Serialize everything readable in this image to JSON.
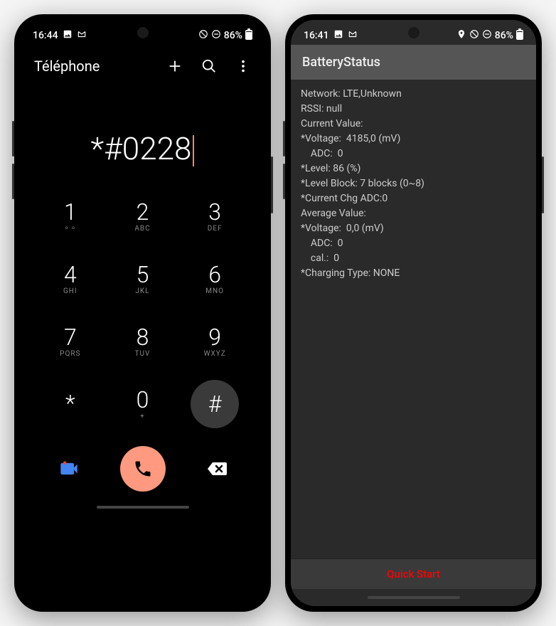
{
  "phone1": {
    "status": {
      "time": "16:44",
      "battery_text": "86%"
    },
    "header": {
      "title": "Téléphone"
    },
    "dialed": "*#0228",
    "keys": [
      {
        "digit": "1",
        "letters": "⚬⚬"
      },
      {
        "digit": "2",
        "letters": "ABC"
      },
      {
        "digit": "3",
        "letters": "DEF"
      },
      {
        "digit": "4",
        "letters": "GHI"
      },
      {
        "digit": "5",
        "letters": "JKL"
      },
      {
        "digit": "6",
        "letters": "MNO"
      },
      {
        "digit": "7",
        "letters": "PQRS"
      },
      {
        "digit": "8",
        "letters": "TUV"
      },
      {
        "digit": "9",
        "letters": "WXYZ"
      },
      {
        "digit": "*",
        "letters": ""
      },
      {
        "digit": "0",
        "letters": "+"
      },
      {
        "digit": "#",
        "letters": ""
      }
    ]
  },
  "phone2": {
    "status": {
      "time": "16:41",
      "battery_text": "86%"
    },
    "header_title": "BatteryStatus",
    "lines": [
      "Network: LTE,Unknown",
      "RSSI: null",
      "",
      "Current Value:",
      "*Voltage:  4185,0 (mV)",
      "    ADC:  0",
      "*Level: 86 (%)",
      "*Level Block: 7 blocks (0~8)",
      "*Current Chg ADC:0",
      "",
      "Average Value:",
      "*Voltage:  0,0 (mV)",
      "    ADC:  0",
      "    cal.:  0",
      "",
      "*Charging Type: NONE"
    ],
    "quick_start": "Quick Start"
  }
}
